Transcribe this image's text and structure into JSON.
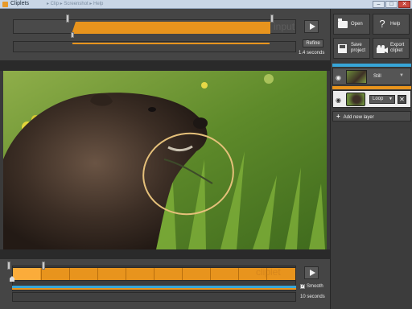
{
  "window": {
    "title": "Cliplets",
    "faded_text": "▸ Clip ▸ Screenshot ▸ Help",
    "controls": [
      "–",
      "□",
      "✕"
    ]
  },
  "top_timeline": {
    "watermark": "input",
    "refine_label": "Refine",
    "duration": "1.4 seconds"
  },
  "bottom_timeline": {
    "watermark": "cliplet",
    "smooth_label": "Smooth",
    "smooth_checked": true,
    "duration": "10 seconds"
  },
  "toolbar": {
    "open_label": "Open",
    "help_label": "Help",
    "save_label_1": "Save",
    "save_label_2": "project",
    "export_label_1": "Export",
    "export_label_2": "cliplet",
    "help_icon": "?"
  },
  "layers": {
    "still_label": "Still",
    "loop_label": "Loop",
    "add_label": "Add new layer"
  },
  "colors": {
    "accent_orange": "#e8941d",
    "accent_blue": "#37a6d8",
    "panel_dark": "#3c3c3c"
  }
}
